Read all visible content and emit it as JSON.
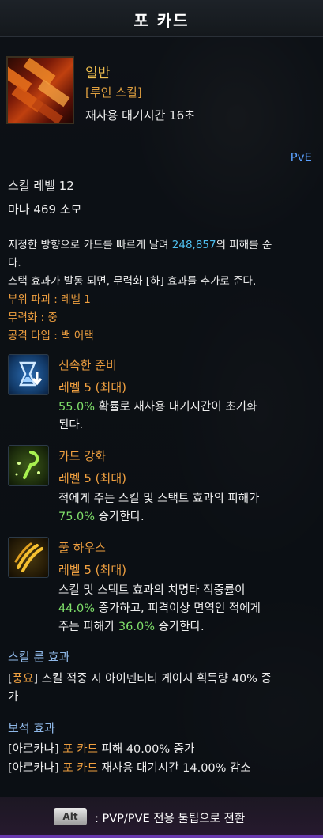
{
  "title": "포 카드",
  "header": {
    "grade": "일반",
    "skill_type": "[루인 스킬]",
    "cooldown": "재사용 대기시간 16초",
    "mode": "PvE"
  },
  "stats": {
    "skill_level": "스킬 레벨 12",
    "mana": "마나 469 소모"
  },
  "description": {
    "line1_prefix": "지정한 방향으로 카드를 빠르게 날려 ",
    "damage": "248,857",
    "line1_suffix": "의 피해를 준",
    "line2": "다.",
    "line3": "스택 효과가 발동 되면, 무력화 [하] 효과를 추가로 준다."
  },
  "attributes": {
    "part_break": "부위 파괴 : 레벨 1",
    "stagger": "무력화 : 중",
    "attack_type": "공격 타입 : 백 어택"
  },
  "tripods": [
    {
      "icon": "hourglass-icon",
      "name": "신속한 준비",
      "level": "레벨 5 (최대)",
      "l1_value": "55.0%",
      "l1_text": " 확률로 재사용 대기시간이 초기화",
      "l2_text": "된다."
    },
    {
      "icon": "card-hook-icon",
      "name": "카드 강화",
      "level": "레벨 5 (최대)",
      "l1_text": "적에게 주는 스킬 및 스택트 효과의 피해가",
      "l2_value": "75.0%",
      "l2_text": " 증가한다."
    },
    {
      "icon": "claw-icon",
      "name": "풀 하우스",
      "level": "레벨 5 (최대)",
      "l1_text": "스킬 및 스택트 효과의 치명타 적중률이",
      "l2_value": "44.0%",
      "l2_text": " 증가하고, 피격이상 면역인 적에게",
      "l3_prefix": "주는 피해가 ",
      "l3_value": "36.0%",
      "l3_text": " 증가한다."
    }
  ],
  "rune": {
    "heading": "스킬 룬 효과",
    "bracket_open": "[",
    "rune_name": "풍요",
    "line1": "] 스킬 적중 시 아이덴티티 게이지 획득량 40% 증",
    "line2": "가"
  },
  "gems": {
    "heading": "보석 효과",
    "g1_prefix": "[아르카나] ",
    "g1_skill": "포 카드",
    "g1_text": " 피해 40.00% 증가",
    "g2_prefix": "[아르카나] ",
    "g2_skill": "포 카드",
    "g2_text": " 재사용 대기시간 14.00% 감소"
  },
  "footer": {
    "key": "Alt",
    "hint": ": PVP/PVE 전용 툴팁으로 전환"
  }
}
